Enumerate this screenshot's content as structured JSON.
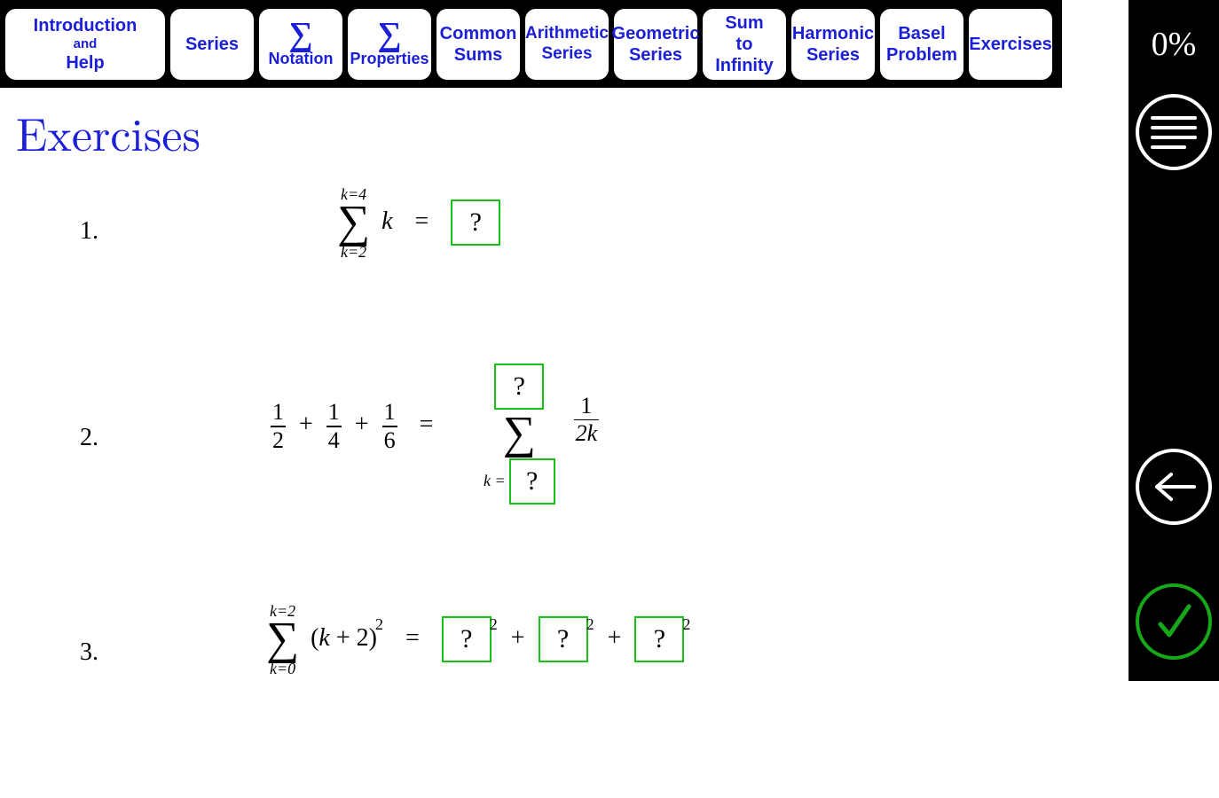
{
  "nav": {
    "intro_line1": "Introduction",
    "intro_line2": "and",
    "intro_line3": "Help",
    "series": "Series",
    "sigma_notation": "Notation",
    "sigma_properties": "Properties",
    "common_sums_l1": "Common",
    "common_sums_l2": "Sums",
    "arith_l1": "Arithmetic",
    "arith_l2": "Series",
    "geo_l1": "Geometric",
    "geo_l2": "Series",
    "suminf_l1": "Sum",
    "suminf_l2": "to",
    "suminf_l3": "Infinity",
    "harm_l1": "Harmonic",
    "harm_l2": "Series",
    "basel_l1": "Basel",
    "basel_l2": "Problem",
    "exercises": "Exercises"
  },
  "sidebar": {
    "progress": "0%"
  },
  "page": {
    "title": "Exercises"
  },
  "ex1": {
    "number": "1.",
    "upper": "k=4",
    "lower": "k=2",
    "term": "k",
    "equals": "=",
    "answer_placeholder": "?"
  },
  "ex2": {
    "number": "2.",
    "frac1_n": "1",
    "frac1_d": "2",
    "frac2_n": "1",
    "frac2_d": "4",
    "frac3_n": "1",
    "frac3_d": "6",
    "plus": "+",
    "equals": "=",
    "upper_placeholder": "?",
    "lower_prefix": "k =",
    "lower_placeholder": "?",
    "term_n": "1",
    "term_d": "2k"
  },
  "ex3": {
    "number": "3.",
    "upper": "k=2",
    "lower": "k=0",
    "term_base": "(k + 2)",
    "term_exp": "2",
    "equals": "=",
    "plus": "+",
    "box_placeholder": "?",
    "box_exp": "2"
  }
}
